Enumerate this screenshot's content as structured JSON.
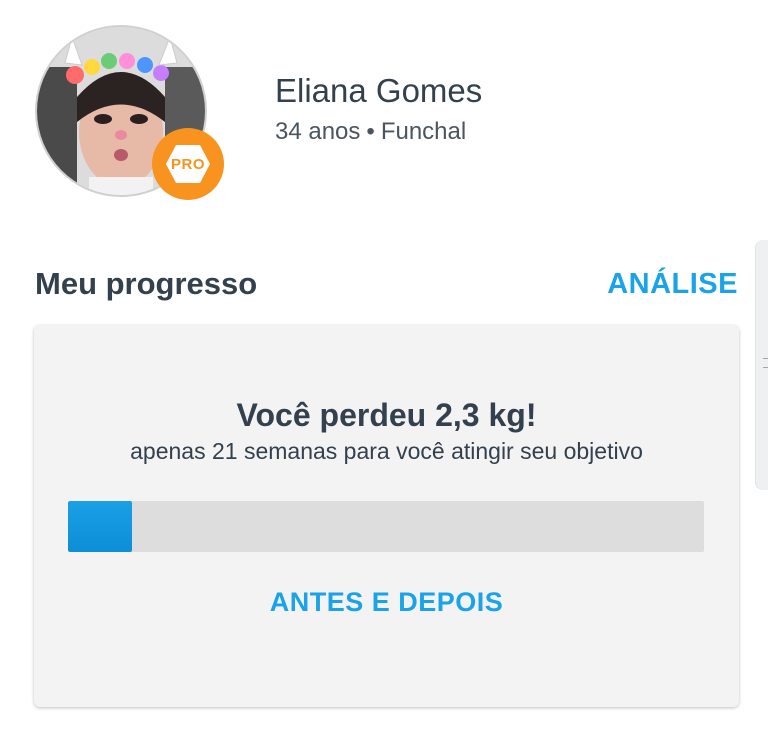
{
  "profile": {
    "name": "Eliana Gomes",
    "age": "34 anos",
    "separator": "•",
    "city": "Funchal",
    "badge_label": "PRO",
    "badge_color": "#f7931e"
  },
  "progress_section": {
    "title": "Meu progresso",
    "analysis_link": "ANÁLISE",
    "headline": "Você perdeu 2,3 kg!",
    "subtitle": "apenas 21 semanas para você atingir seu objetivo",
    "progress_fraction": 0.1,
    "before_after_link": "ANTES E DEPOIS"
  },
  "colors": {
    "accent": "#1aa3e8",
    "text": "#33404d",
    "card_bg": "#f3f3f3",
    "track_bg": "#dddddd"
  }
}
